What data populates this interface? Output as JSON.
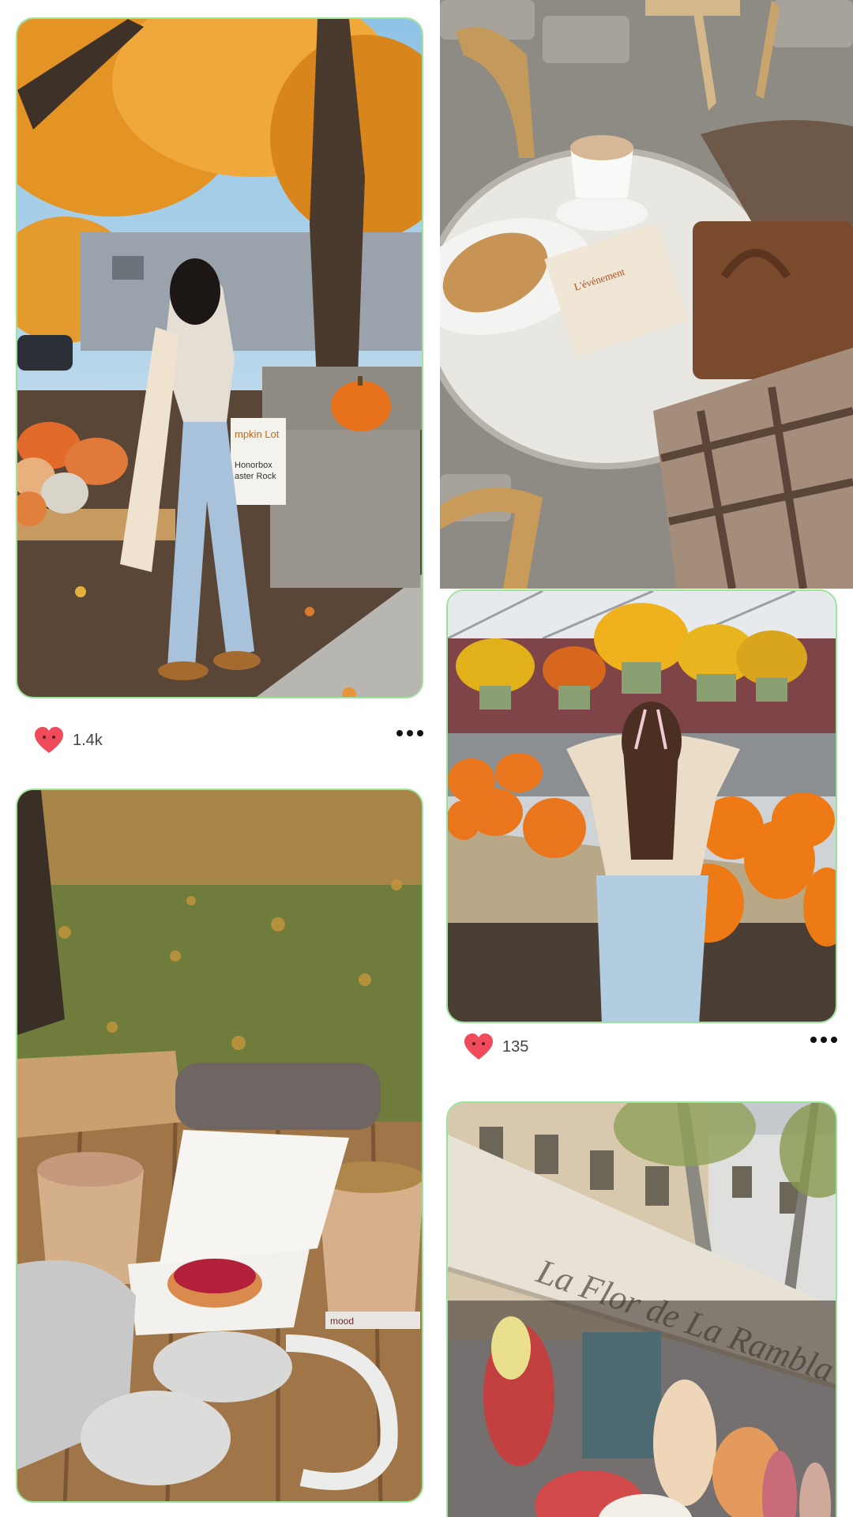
{
  "feed": {
    "posts": [
      {
        "likes": "1.4k",
        "scene": "Girl browsing a pumpkin stand under autumn trees"
      },
      {
        "likes": "",
        "scene": "Café table with latte, croissant and book"
      },
      {
        "likes": "135",
        "scene": "Girl with bow in front of pumpkins and hanging mums"
      },
      {
        "likes": "",
        "scene": "Picnic table with coffees, tart and headphones on fallen leaves"
      },
      {
        "likes": "",
        "scene": "Flower shop storefront"
      }
    ],
    "sign_pumpkin": [
      "mpkin Lot",
      "Honorbox",
      "aster Rock"
    ],
    "book_title": "L'événement",
    "shop_sign": "La Flor de La Rambla",
    "mug_brand": "mood"
  },
  "colors": {
    "card_border": "#9ee39a",
    "heart": "#ef4b5b"
  }
}
